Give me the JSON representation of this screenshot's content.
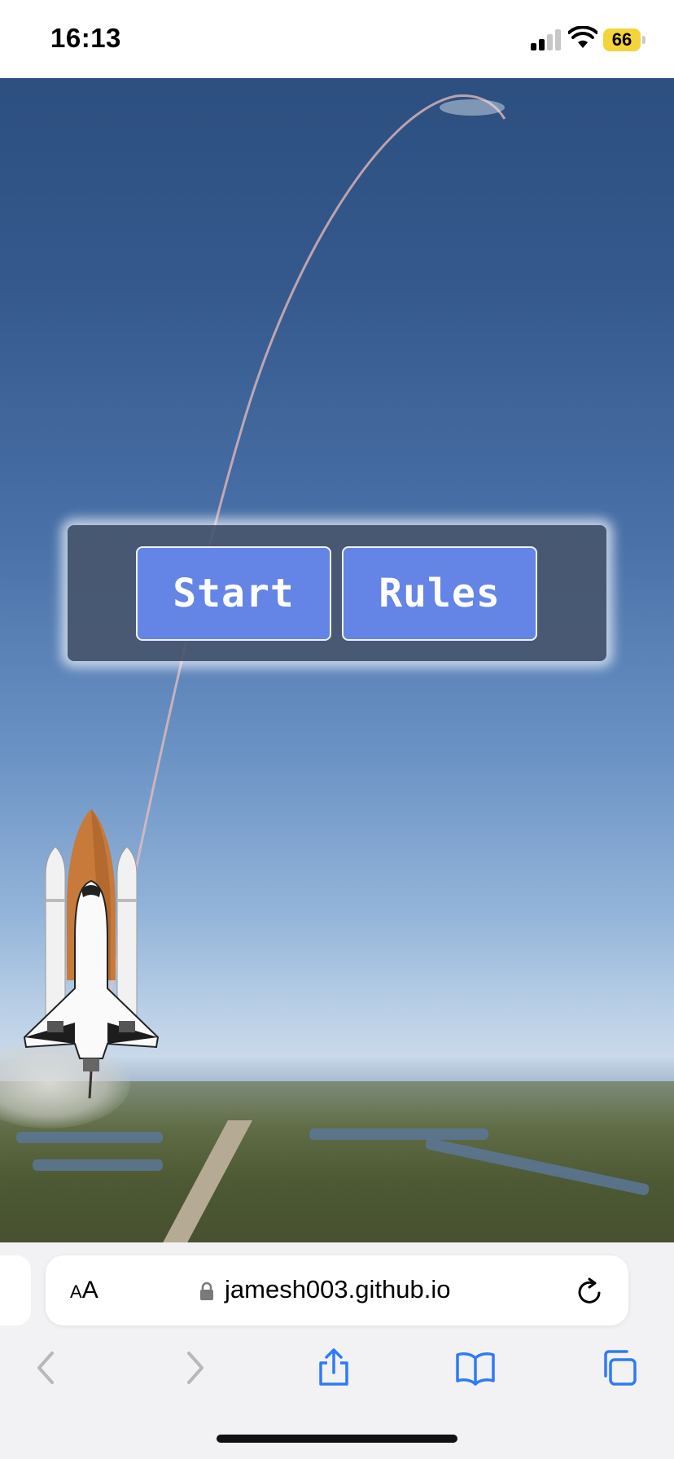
{
  "status_bar": {
    "time": "16:13",
    "battery": "66",
    "icons": [
      "cellular-signal-icon",
      "wifi-icon",
      "battery-icon"
    ]
  },
  "game": {
    "buttons": {
      "start_label": "Start",
      "rules_label": "Rules"
    },
    "colors": {
      "button_fill": "#6585e6",
      "panel_fill": "#48566e"
    }
  },
  "browser": {
    "text_size_label_small": "A",
    "text_size_label_large": "A",
    "url": "jamesh003.github.io",
    "toolbar": [
      "back-icon",
      "forward-icon",
      "share-icon",
      "bookmarks-icon",
      "tabs-icon"
    ],
    "accent_color": "#2f7bf5"
  }
}
